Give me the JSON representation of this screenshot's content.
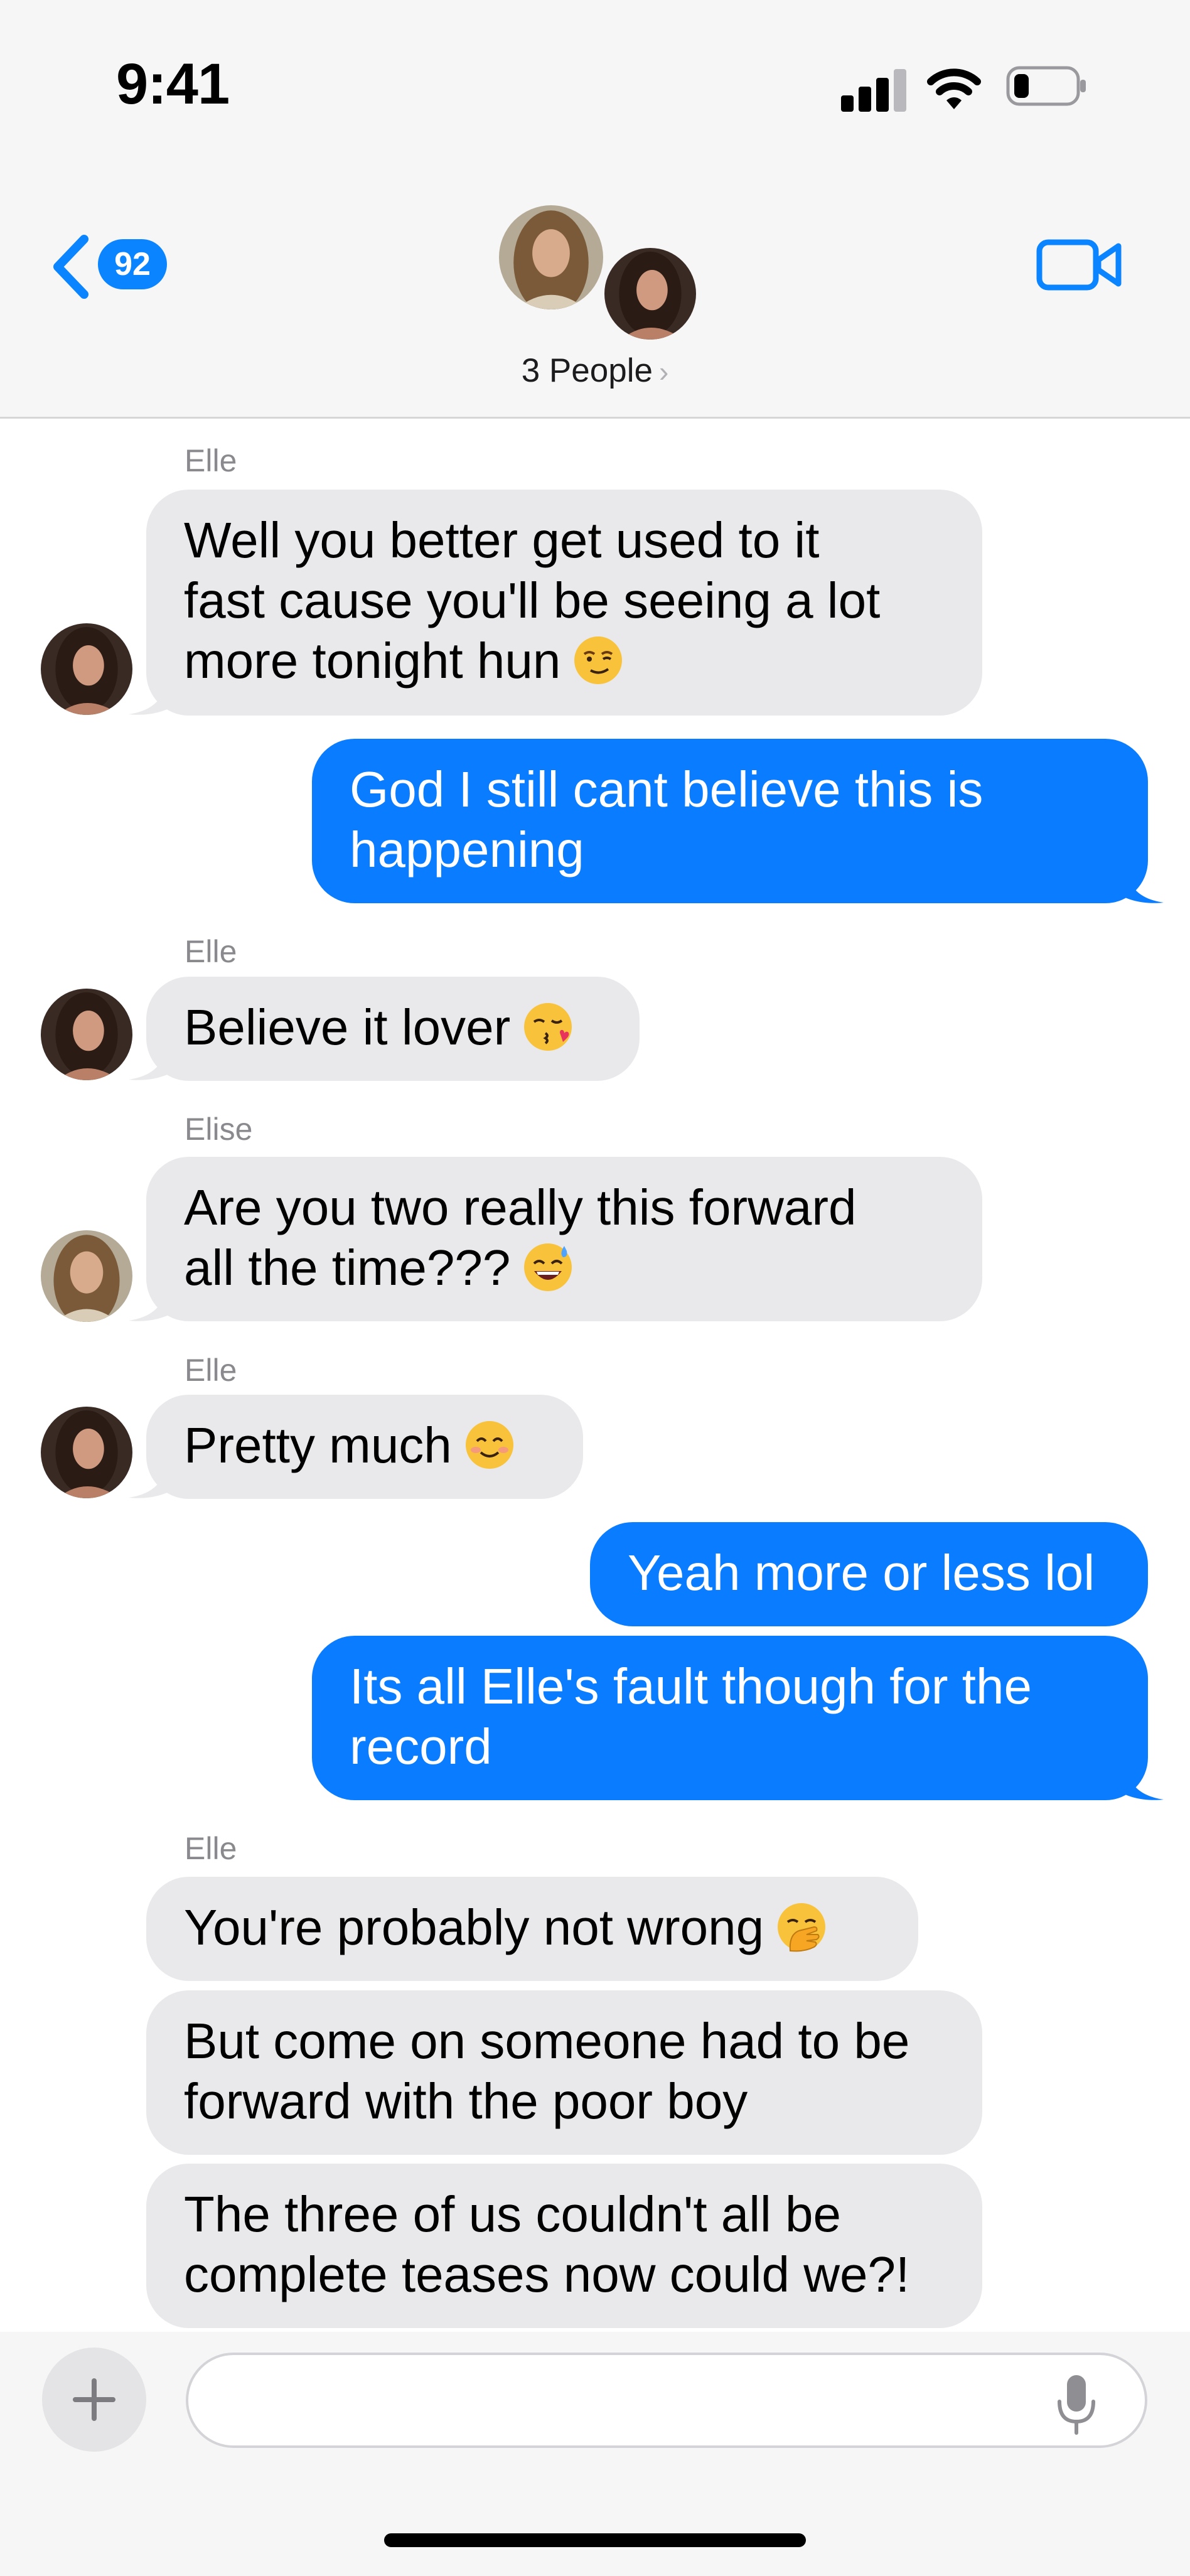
{
  "status_bar": {
    "time": "9:41",
    "battery_level": 0.25
  },
  "header": {
    "back_count": "92",
    "title": "3 People",
    "title_chevron": "›"
  },
  "messages": [
    {
      "direction": "incoming",
      "sender": "Elle",
      "lines": [
        "Well you better get used to it",
        "fast cause you'll be seeing a lot",
        "more tonight hun"
      ],
      "emoji": "smirk-emoji"
    },
    {
      "direction": "outgoing",
      "lines": [
        "God I still cant believe this is",
        "happening"
      ]
    },
    {
      "direction": "incoming",
      "sender": "Elle",
      "lines": [
        "Believe it lover"
      ],
      "emoji": "kiss-emoji"
    },
    {
      "direction": "incoming",
      "sender": "Elise",
      "lines": [
        "Are you two really this forward",
        "all the time???"
      ],
      "emoji": "sweat-smile-emoji"
    },
    {
      "direction": "incoming",
      "sender": "Elle",
      "lines": [
        "Pretty much"
      ],
      "emoji": "smile-emoji"
    },
    {
      "direction": "outgoing",
      "lines": [
        "Yeah more or less lol"
      ]
    },
    {
      "direction": "outgoing",
      "lines": [
        "Its all Elle's fault though for the",
        "record"
      ]
    },
    {
      "direction": "incoming",
      "sender": "Elle",
      "lines": [
        "You're probably not wrong"
      ],
      "emoji": "hand-over-mouth-emoji"
    },
    {
      "direction": "incoming",
      "lines": [
        "But come on someone had to be",
        "forward with the poor boy"
      ]
    },
    {
      "direction": "incoming",
      "lines": [
        "The three of us couldn't all be",
        "complete teases now could we?!"
      ]
    }
  ],
  "composer": {
    "placeholder": "",
    "plus_icon": "plus-icon",
    "mic_icon": "microphone-icon"
  },
  "colors": {
    "accent": "#0a7cff",
    "incoming_bubble": "#e9e9eb",
    "sender_label": "#8a8a8e",
    "header_bg": "#f6f6f6"
  }
}
